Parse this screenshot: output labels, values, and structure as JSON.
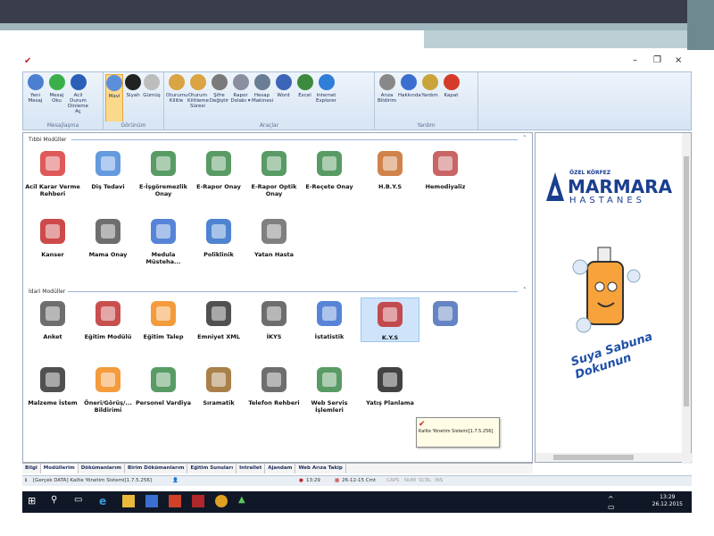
{
  "window": {
    "minimize": "–",
    "maximize": "❐",
    "close": "×"
  },
  "ribbon": {
    "groups": [
      {
        "title": "Mesajlaşma",
        "buttons": [
          {
            "label": "Yeni Mesaj",
            "icon": "new-message-icon",
            "color": "#4a7fd1"
          },
          {
            "label": "Mesaj Oku",
            "icon": "read-message-icon",
            "color": "#3bb04a"
          },
          {
            "label": "Acil Durum Dinleme Aç",
            "icon": "emergency-listen-icon",
            "color": "#2b5fb8"
          }
        ]
      },
      {
        "title": "Görünüm",
        "buttons": [
          {
            "label": "Mavi",
            "icon": "blue-theme-icon",
            "color": "#5b8fdc",
            "selected": true
          },
          {
            "label": "Siyah",
            "icon": "black-theme-icon",
            "color": "#222222"
          },
          {
            "label": "Gümüş",
            "icon": "silver-theme-icon",
            "color": "#bdbdbd"
          }
        ]
      },
      {
        "title": "Araçlar",
        "buttons": [
          {
            "label": "Oturumu Kilitle",
            "icon": "lock-session-icon",
            "color": "#d9a441"
          },
          {
            "label": "Oturum Kilitleme Süresi",
            "icon": "lock-timer-icon",
            "color": "#d9a441"
          },
          {
            "label": "Şifre Değiştir",
            "icon": "password-icon",
            "color": "#7a7a7a"
          },
          {
            "label": "Rapor Dolabı ▾",
            "icon": "printer-icon",
            "color": "#8a8fa0"
          },
          {
            "label": "Hesap Makinesi",
            "icon": "calculator-icon",
            "color": "#6a7d95"
          },
          {
            "label": "Word",
            "icon": "word-icon",
            "color": "#3c64b8"
          },
          {
            "label": "Excel",
            "icon": "excel-icon",
            "color": "#3c8a3c"
          },
          {
            "label": "Internet Explorer",
            "icon": "ie-icon",
            "color": "#2f7fd8"
          }
        ]
      },
      {
        "title": "Yardım",
        "buttons": [
          {
            "label": "Arıza Bildirim",
            "icon": "tools-icon",
            "color": "#888888"
          },
          {
            "label": "Hakkında",
            "icon": "info-icon",
            "color": "#3a6fd0"
          },
          {
            "label": "Yardım",
            "icon": "help-icon",
            "color": "#c9a43a"
          },
          {
            "label": "Kapat",
            "icon": "close-app-icon",
            "color": "#d63a2a"
          }
        ]
      }
    ]
  },
  "sections": {
    "medical": "Tıbbi Modüller",
    "admin": "İdari Modüller"
  },
  "medical_items": [
    {
      "label": "Acil Karar Verme Rehberi",
      "icon": "ambulance-icon",
      "color": "#d83c3c"
    },
    {
      "label": "Diş Tedavi",
      "icon": "dentist-icon",
      "color": "#4a8ad8"
    },
    {
      "label": "E-İşgöremezlik Onay",
      "icon": "globe-doc-icon",
      "color": "#3c8a4a"
    },
    {
      "label": "E-Rapor Onay",
      "icon": "globe-doc-icon",
      "color": "#3c8a4a"
    },
    {
      "label": "E-Rapor Optik Onay",
      "icon": "globe-doc-icon",
      "color": "#3c8a4a"
    },
    {
      "label": "E-Reçete Onay",
      "icon": "globe-doc-icon",
      "color": "#3c8a4a"
    },
    {
      "label": "H.B.Y.S",
      "icon": "operator-icon",
      "color": "#c86d2a"
    },
    {
      "label": "Hemodiyaliz",
      "icon": "doctor-icon",
      "color": "#c04a4a"
    },
    {
      "label": "Kanser",
      "icon": "cancer-icon",
      "color": "#c42a2a"
    },
    {
      "label": "Mama Onay",
      "icon": "checklist-icon",
      "color": "#555555"
    },
    {
      "label": "Medula Müsteha...",
      "icon": "medula-icon",
      "color": "#3a6fd0"
    },
    {
      "label": "Poliklinik",
      "icon": "user-icon",
      "color": "#2f6fc8"
    },
    {
      "label": "Yatan Hasta",
      "icon": "phone-fax-icon",
      "color": "#6a6a6a"
    }
  ],
  "admin_items": [
    {
      "label": "Anket",
      "icon": "survey-icon",
      "color": "#555555"
    },
    {
      "label": "Eğitim Modülü",
      "icon": "chart-icon",
      "color": "#c03030"
    },
    {
      "label": "Eğitim Talep",
      "icon": "rss-icon",
      "color": "#f28a1a"
    },
    {
      "label": "Emniyet XML",
      "icon": "clipboard-icon",
      "color": "#333333"
    },
    {
      "label": "İKYS",
      "icon": "people-icon",
      "color": "#555555"
    },
    {
      "label": "İstatistik",
      "icon": "magnifier-icon",
      "color": "#3a6fd0"
    },
    {
      "label": "K.Y.S",
      "icon": "chart-icon",
      "color": "#c03030",
      "selected": true
    },
    {
      "label": "",
      "icon": "folder-icon",
      "color": "#4a6fb8"
    },
    {
      "label": "Malzeme İstem",
      "icon": "clipboard-icon",
      "color": "#333333"
    },
    {
      "label": "Öneri/Görüş/... Bildirimi",
      "icon": "rss-icon",
      "color": "#f28a1a"
    },
    {
      "label": "Personel Vardiya",
      "icon": "globe-doc-icon",
      "color": "#3c8a4a"
    },
    {
      "label": "Sıramatik",
      "icon": "abacus-icon",
      "color": "#9a6a2a"
    },
    {
      "label": "Telefon Rehberi",
      "icon": "phone-icon",
      "color": "#555555"
    },
    {
      "label": "Web Servis İşlemleri",
      "icon": "globe-doc-icon",
      "color": "#3c8a4a"
    },
    {
      "label": "Yatış Planlama",
      "icon": "headset-icon",
      "color": "#222222"
    }
  ],
  "tooltip": {
    "text": "Kalite Yönetim Sistemi[1.7.5.256]"
  },
  "hospital": {
    "small": "ÖZEL KÖRFEZ",
    "name": "MARMARA",
    "sub": "HASTANES",
    "slogan": "Suya Sabuna Dokunun"
  },
  "tabs": [
    "Bilgi",
    "Modüllerim",
    "Dökümanlarım",
    "Birim Dökümanlarım",
    "Eğitim Sunuları",
    "Intrallet",
    "Ajandam",
    "Web Arıza Takip"
  ],
  "status": {
    "left": "[Gerçek DATA] Kalite Yönetim Sistemi[1.7.5.256]",
    "time": "13:29",
    "date": "26-12-15 Cmt",
    "caps": "CAPS",
    "num": "NUM",
    "scrl": "SCRL",
    "ins": "INS"
  },
  "taskbar": {
    "time": "13:29",
    "date": "26.12.2015"
  }
}
